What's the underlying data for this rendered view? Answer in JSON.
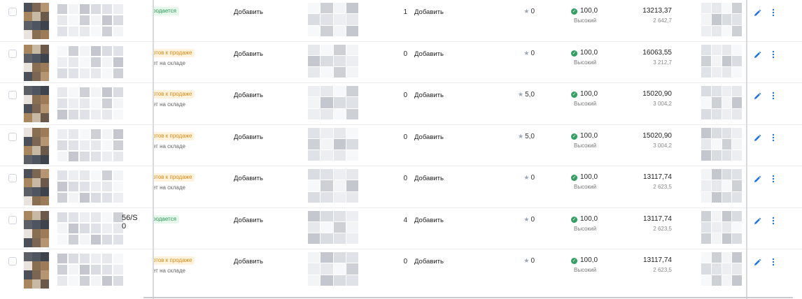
{
  "colors": {
    "status_green_bg": "#e6f7ec",
    "status_green_text": "#2c9a57",
    "status_orange_bg": "#fff3dd",
    "status_orange_text": "#d98a14",
    "score_ok": "#2ea05f",
    "action_icon": "#1a73e8"
  },
  "icons": {
    "checkbox": "checkbox",
    "star": "star-icon",
    "score_ok": "check-circle-icon",
    "edit": "pencil-icon",
    "more": "more-vertical-icon"
  },
  "rows": [
    {
      "sku_fragment": "",
      "status": "родается",
      "status_kind": "green",
      "status_sub": "",
      "add_label_a": "Добавить",
      "qty": "1",
      "add_label_b": "Добавить",
      "rating": "0",
      "score": "100,0",
      "score_label": "Высокий",
      "price": "13213,37",
      "price_sub": "2 642,7"
    },
    {
      "sku_fragment": "",
      "status": "отов к продаже",
      "status_kind": "orange",
      "status_sub": "ет на складе",
      "add_label_a": "Добавить",
      "qty": "0",
      "add_label_b": "Добавить",
      "rating": "0",
      "score": "100,0",
      "score_label": "Высокий",
      "price": "16063,55",
      "price_sub": "3 212,7"
    },
    {
      "sku_fragment": "",
      "status": "отов к продаже",
      "status_kind": "orange",
      "status_sub": "ет на складе",
      "add_label_a": "Добавить",
      "qty": "0",
      "add_label_b": "Добавить",
      "rating": "5,0",
      "score": "100,0",
      "score_label": "Высокий",
      "price": "15020,90",
      "price_sub": "3 004,2"
    },
    {
      "sku_fragment": "",
      "status": "отов к продаже",
      "status_kind": "orange",
      "status_sub": "ет на складе",
      "add_label_a": "Добавить",
      "qty": "0",
      "add_label_b": "Добавить",
      "rating": "5,0",
      "score": "100,0",
      "score_label": "Высокий",
      "price": "15020,90",
      "price_sub": "3 004,2"
    },
    {
      "sku_fragment": "",
      "status": "отов к продаже",
      "status_kind": "orange",
      "status_sub": "ет на складе",
      "add_label_a": "Добавить",
      "qty": "0",
      "add_label_b": "Добавить",
      "rating": "0",
      "score": "100,0",
      "score_label": "Высокий",
      "price": "13117,74",
      "price_sub": "2 623,5"
    },
    {
      "sku_fragment": "56/S\n0",
      "status": "родается",
      "status_kind": "green",
      "status_sub": "",
      "add_label_a": "Добавить",
      "qty": "4",
      "add_label_b": "Добавить",
      "rating": "0",
      "score": "100,0",
      "score_label": "Высокий",
      "price": "13117,74",
      "price_sub": "2 623,5"
    },
    {
      "sku_fragment": "",
      "status": "отов к продаже",
      "status_kind": "orange",
      "status_sub": "ет на складе",
      "add_label_a": "Добавить",
      "qty": "0",
      "add_label_b": "Добавить",
      "rating": "0",
      "score": "100,0",
      "score_label": "Высокий",
      "price": "13117,74",
      "price_sub": "2 623,5"
    }
  ]
}
